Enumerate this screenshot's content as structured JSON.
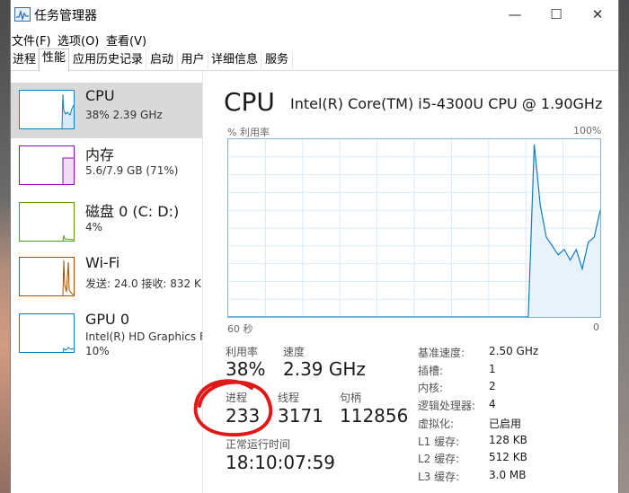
{
  "window": {
    "title": "任务管理器",
    "controls": {
      "minimize": "—",
      "maximize": "☐",
      "close": "✕"
    }
  },
  "menu": [
    "文件(F)",
    "选项(O)",
    "查看(V)"
  ],
  "tabs": [
    "进程",
    "性能",
    "应用历史记录",
    "启动",
    "用户",
    "详细信息",
    "服务"
  ],
  "active_tab": "性能",
  "sidebar": {
    "items": [
      {
        "name": "CPU",
        "detail": "38% 2.39 GHz",
        "color": "#117dbb",
        "selected": true
      },
      {
        "name": "内存",
        "detail": "5.6/7.9 GB (71%)",
        "color": "#8b12ae",
        "selected": false
      },
      {
        "name": "磁盘 0 (C: D:)",
        "detail": "4%",
        "color": "#4da60c",
        "selected": false
      },
      {
        "name": "Wi-Fi",
        "detail": "发送: 24.0  接收: 832 K",
        "color": "#a74f01",
        "selected": false
      },
      {
        "name": "GPU 0",
        "detail": "Intel(R) HD Graphics F",
        "detail2": "10%",
        "color": "#117dbb",
        "selected": false
      }
    ]
  },
  "main": {
    "title": "CPU",
    "model": "Intel(R) Core(TM) i5-4300U CPU @ 1.90GHz",
    "chart_label_left": "% 利用率",
    "chart_label_right": "100%",
    "axis_left": "60 秒",
    "axis_right": "0",
    "stats": {
      "utilization_label": "利用率",
      "utilization": "38%",
      "speed_label": "速度",
      "speed": "2.39 GHz",
      "processes_label": "进程",
      "processes": "233",
      "threads_label": "线程",
      "threads": "3171",
      "handles_label": "句柄",
      "handles": "112856",
      "uptime_label": "正常运行时间",
      "uptime": "18:10:07:59"
    },
    "details": [
      {
        "label": "基准速度:",
        "value": "2.50 GHz"
      },
      {
        "label": "插槽:",
        "value": "1"
      },
      {
        "label": "内核:",
        "value": "2"
      },
      {
        "label": "逻辑处理器:",
        "value": "4"
      },
      {
        "label": "虚拟化:",
        "value": "已启用"
      },
      {
        "label": "L1 缓存:",
        "value": "128 KB"
      },
      {
        "label": "L2 缓存:",
        "value": "512 KB"
      },
      {
        "label": "L3 缓存:",
        "value": "3.0 MB"
      }
    ]
  },
  "cpu_usage_series": [
    0,
    0,
    0,
    0,
    0,
    0,
    0,
    0,
    0,
    0,
    0,
    0,
    0,
    0,
    0,
    0,
    0,
    0,
    0,
    0,
    0,
    0,
    0,
    0,
    0,
    0,
    0,
    0,
    0,
    0,
    0,
    0,
    0,
    0,
    0,
    0,
    0,
    0,
    0,
    0,
    0,
    0,
    0,
    0,
    0,
    0,
    0,
    0,
    0,
    0,
    0,
    97,
    63,
    45,
    40,
    35,
    38,
    32,
    38,
    27,
    42,
    45,
    60
  ],
  "annotation_color": "#e01818"
}
